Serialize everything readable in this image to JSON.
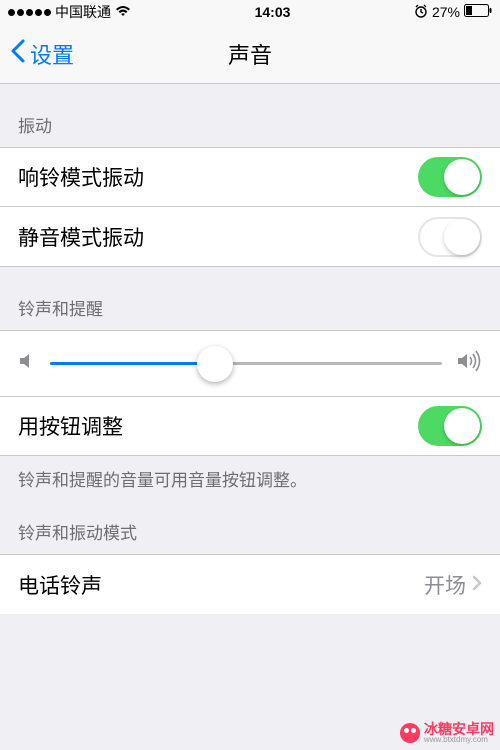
{
  "status": {
    "carrier": "中国联通",
    "time": "14:03",
    "battery_percent": "27%"
  },
  "nav": {
    "back_label": "设置",
    "title": "声音"
  },
  "sections": {
    "vibrate": {
      "header": "振动",
      "ring_label": "响铃模式振动",
      "ring_on": true,
      "silent_label": "静音模式振动",
      "silent_on": false
    },
    "ringer": {
      "header": "铃声和提醒",
      "volume_percent": 42,
      "buttons_label": "用按钮调整",
      "buttons_on": true,
      "footer": "铃声和提醒的音量可用音量按钮调整。"
    },
    "patterns": {
      "header": "铃声和振动模式",
      "ringtone_label": "电话铃声",
      "ringtone_value": "开场"
    }
  },
  "watermark": {
    "cn": "冰糖安卓网",
    "en": "www.btxtdmy.com"
  }
}
